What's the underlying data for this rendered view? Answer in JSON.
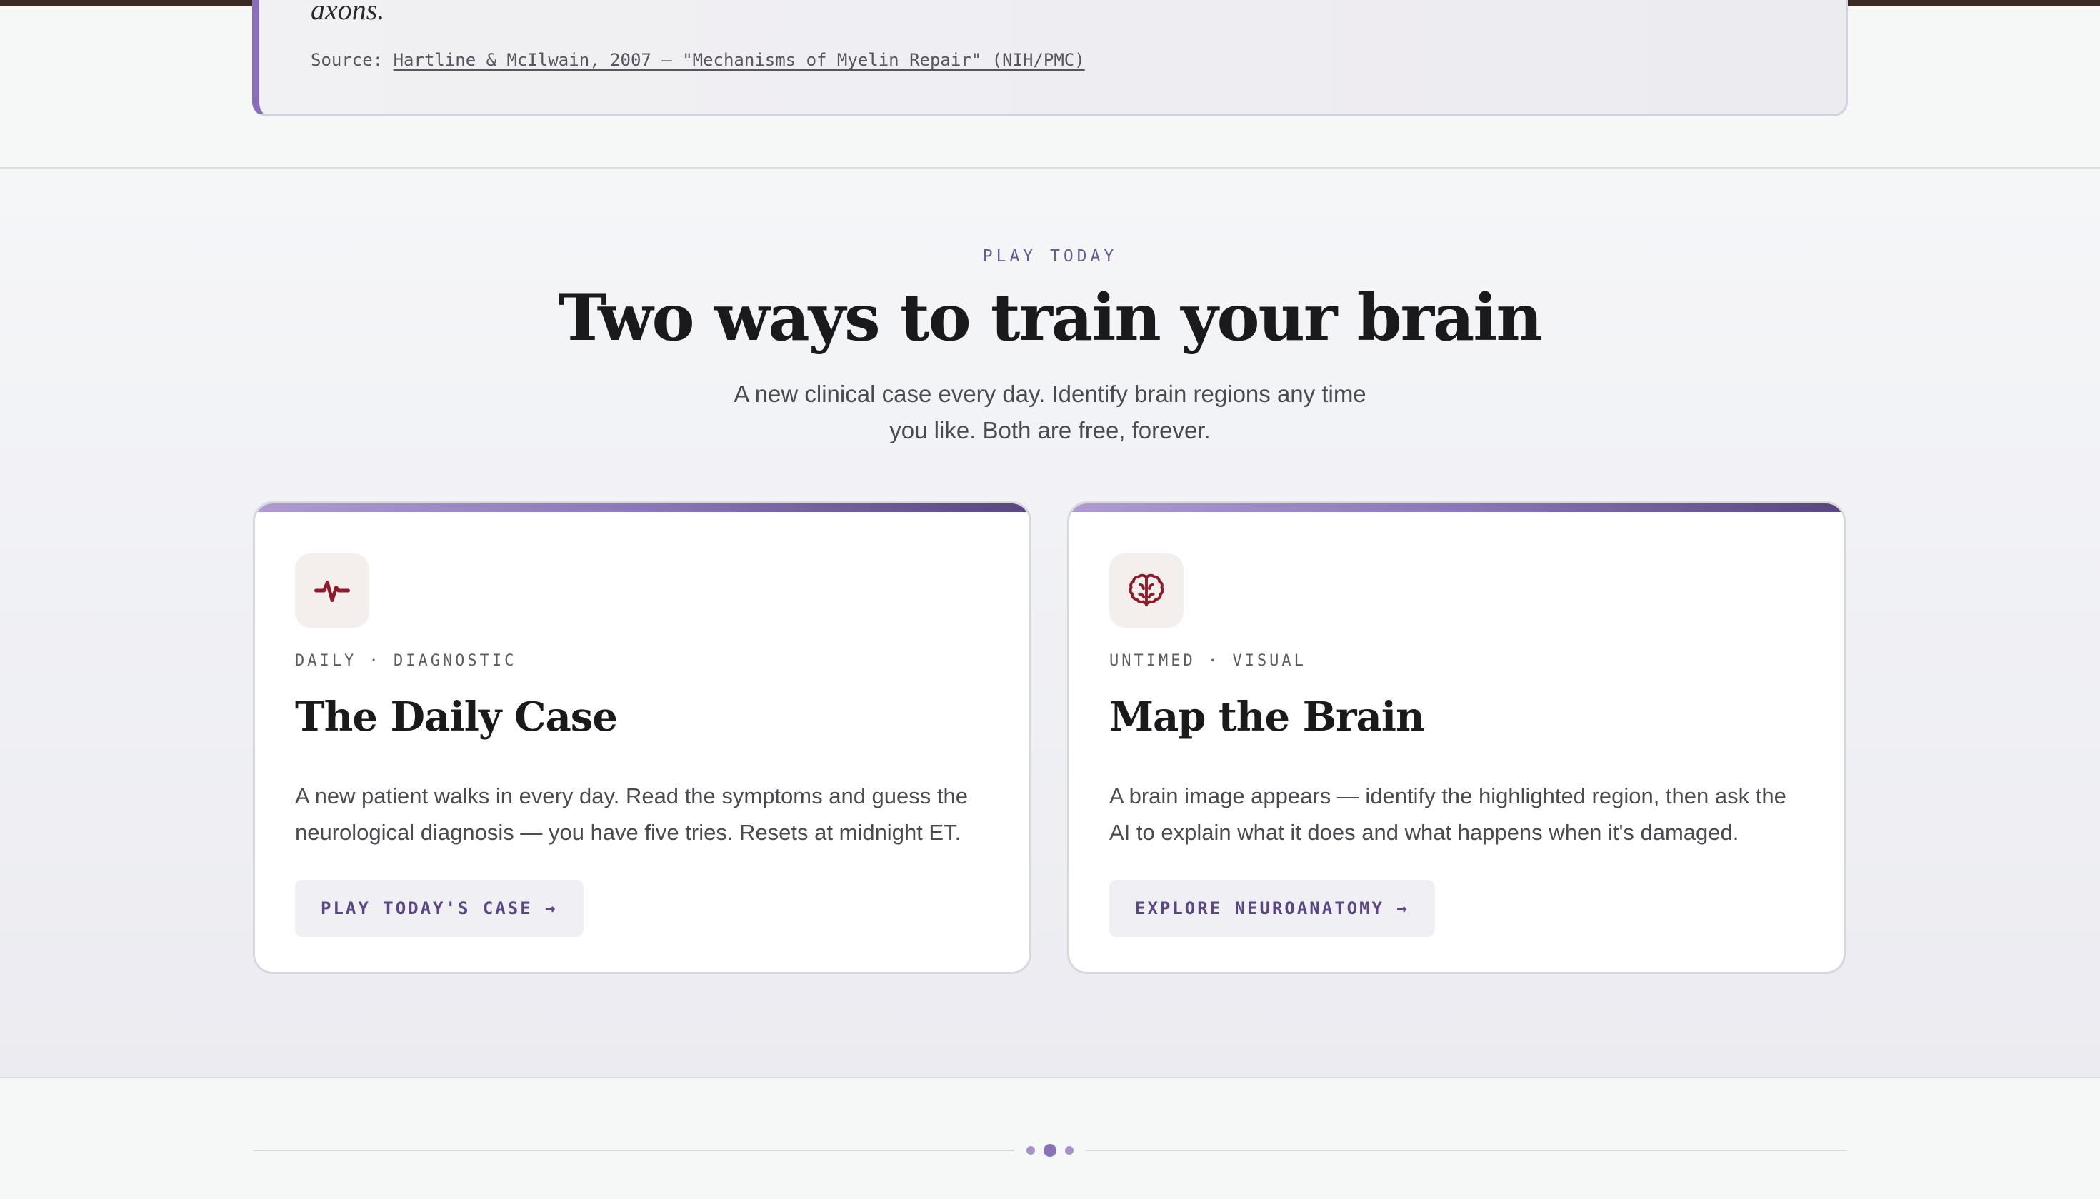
{
  "quote": {
    "tail_text": "axons.",
    "source_label": "Source:",
    "source_link": "Hartline & McIlwain, 2007 — \"Mechanisms of Myelin Repair\" (NIH/PMC)"
  },
  "play": {
    "eyebrow": "PLAY TODAY",
    "title": "Two ways to train your brain",
    "subtitle": "A new clinical case every day. Identify brain regions any time you like. Both are free, forever.",
    "cards": [
      {
        "icon": "pulse-icon",
        "tag": "DAILY · DIAGNOSTIC",
        "title": "The Daily Case",
        "description": "A new patient walks in every day. Read the symptoms and guess the neurological diagnosis — you have five tries. Resets at midnight ET.",
        "button": "PLAY TODAY'S CASE →"
      },
      {
        "icon": "brain-icon",
        "tag": "UNTIMED · VISUAL",
        "title": "Map the Brain",
        "description": "A brain image appears — identify the highlighted region, then ask the AI to explain what it does and what happens when it's damaged.",
        "button": "EXPLORE NEUROANATOMY →"
      }
    ]
  },
  "colors": {
    "accent": "#8a6fb8",
    "icon_red": "#8a1c2b",
    "button_text": "#5b4583"
  }
}
